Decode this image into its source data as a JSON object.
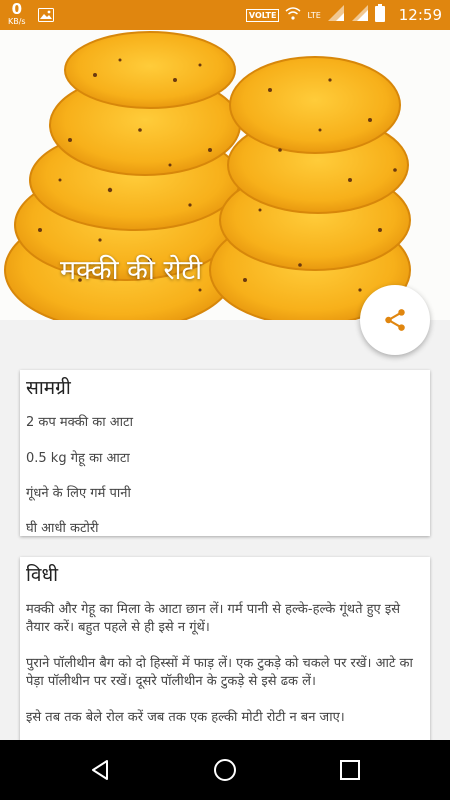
{
  "status_bar": {
    "speed_value": "0",
    "speed_unit": "KB/s",
    "volte": "VOLTE",
    "lte": "LTE",
    "time": "12:59",
    "bg_color": "#e0860f"
  },
  "hero": {
    "title": "मक्की की रोटी"
  },
  "fab": {
    "icon": "share-icon",
    "color": "#e0860f"
  },
  "ingredients": {
    "title": "सामग्री",
    "items": [
      "2 कप मक्की का आटा",
      "0.5 kg  गेहू का आटा",
      "गूंधने के लिए गर्म पानी",
      "घी आधी कटोरी"
    ]
  },
  "method": {
    "title": "विधी",
    "paragraphs": [
      "मक्की और गेहू का मिला के आटा छान लें। गर्म पानी से हल्के-हल्के गूंथते हुए इसे तैयार करें। बहुत पहले से ही इसे न गूंथें।",
      "पुराने पॉलीथीन बैग को दो हिस्सों में फाड़ लें। एक टुकड़े को चकले पर रखें। आटे का पेड़ा पॉलीथीन पर रखें। दूसरे पॉलीथीन के टुकड़े से इसे ढक लें।",
      "इसे तब तक बेले रोल करें जब तक एक हल्की मोटी रोटी न बन जाए।"
    ]
  },
  "nav": {
    "back_icon": "back-triangle-icon",
    "home_icon": "home-circle-icon",
    "recents_icon": "recents-square-icon"
  }
}
